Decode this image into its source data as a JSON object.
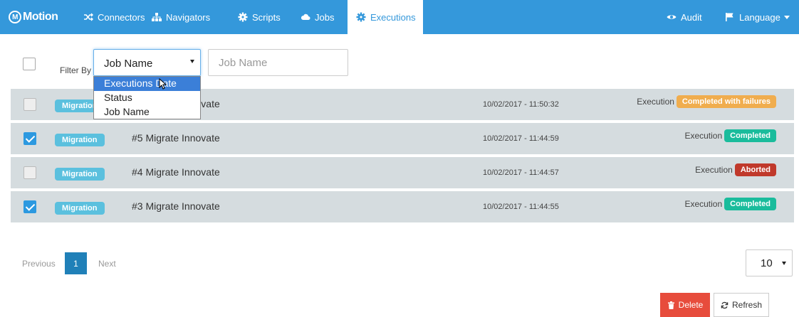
{
  "brand": {
    "letter": "M",
    "name": "Motion"
  },
  "nav": {
    "items": [
      {
        "label": "Connectors",
        "icon": "connectors-icon"
      },
      {
        "label": "Navigators",
        "icon": "sitemap-icon"
      },
      {
        "label": "Scripts",
        "icon": "gear-icon"
      },
      {
        "label": "Jobs",
        "icon": "cloud-icon"
      },
      {
        "label": "Executions",
        "icon": "gear-icon",
        "active": true
      }
    ],
    "right": [
      {
        "label": "Audit",
        "icon": "eye-icon"
      },
      {
        "label": "Language",
        "icon": "flag-icon",
        "caret": true
      }
    ]
  },
  "filter": {
    "label": "Filter By",
    "selected": "Job Name",
    "options": [
      "Executions Date",
      "Status",
      "Job Name"
    ],
    "highlighted": "Executions Date",
    "placeholder": "Job Name"
  },
  "rows": [
    {
      "tag": "Migration",
      "name": "#6 Migrate Innovate",
      "date": "10/02/2017 - 11:50:32",
      "exec_label": "Execution",
      "status": "Completed with failures",
      "status_color": "#f0ad4e",
      "checked": false
    },
    {
      "tag": "Migration",
      "name": "#5 Migrate Innovate",
      "date": "10/02/2017 - 11:44:59",
      "exec_label": "Execution",
      "status": "Completed",
      "status_color": "#1abc9c",
      "checked": true
    },
    {
      "tag": "Migration",
      "name": "#4 Migrate Innovate",
      "date": "10/02/2017 - 11:44:57",
      "exec_label": "Execution",
      "status": "Aborted",
      "status_color": "#c0392b",
      "checked": false
    },
    {
      "tag": "Migration",
      "name": "#3 Migrate Innovate",
      "date": "10/02/2017 - 11:44:55",
      "exec_label": "Execution",
      "status": "Completed",
      "status_color": "#1abc9c",
      "checked": true
    }
  ],
  "pagination": {
    "prev": "Previous",
    "current": "1",
    "next": "Next",
    "page_size": "10"
  },
  "actions": {
    "delete": "Delete",
    "refresh": "Refresh"
  },
  "colors": {
    "navbar": "#3498db",
    "tag": "#5bc0de",
    "row": "#d5dcdf",
    "delete": "#e74c3c"
  }
}
